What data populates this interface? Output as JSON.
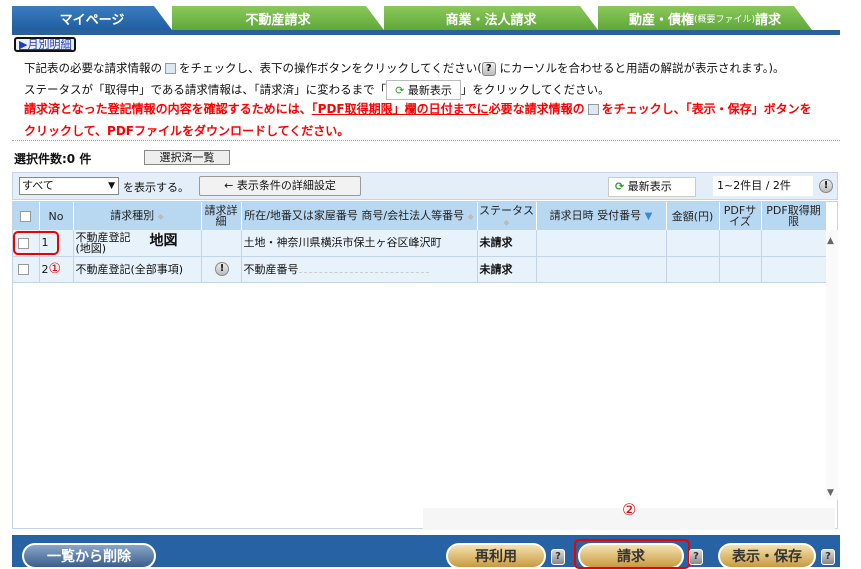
{
  "tabs": [
    "マイページ",
    "不動産請求",
    "商業・法人請求",
    "動産・債権",
    "(概要ファイル)",
    "請求"
  ],
  "monthly_link": "月別明細",
  "instructions": {
    "l1a": "下記表の必要な請求情報の",
    "l1b": "をチェックし、表下の操作ボタンをクリックしてください(",
    "l1c": "にカーソルを合わせると用語の解説が表示されます。)。",
    "l2a": "ステータスが「取得中」である請求情報は、「請求済」に変わるまで「",
    "l2btn": "最新表示",
    "l2b": "」をクリックしてください。",
    "r1a": "請求済となった登記情報の内容を確認するためには、",
    "r1link": "「PDF取得期限」欄の日付までに",
    "r1b": "必要な請求情報の",
    "r1c": "をチェックし、「表示・保存」ボタンを",
    "r2": "クリックして、PDFファイルをダウンロードしてください。"
  },
  "selection": {
    "count_label": "選択件数:0 件",
    "list_button": "選択済一覧"
  },
  "toolbar": {
    "filter_value": "すべて",
    "filter_suffix": "を表示する。",
    "detail_button": "← 表示条件の詳細設定",
    "refresh_button": "最新表示",
    "range": "1~2件目 / 2件"
  },
  "columns": [
    "No",
    "請求種別",
    "請求詳細",
    "所在/地番又は家屋番号 商号/会社法人等番号",
    "ステータス",
    "請求日時 受付番号",
    "金額(円)",
    "PDFサイズ",
    "PDF取得期限"
  ],
  "rows": [
    {
      "no": "1",
      "type": "不動産登記(地図)",
      "annotation": "地図",
      "location": "土地・神奈川県横浜市保土ヶ谷区峰沢町",
      "status": "未請求"
    },
    {
      "no": "2",
      "type": "不動産登記(全部事項)",
      "annotation": "①",
      "location": "不動産番号",
      "status": "未請求"
    }
  ],
  "annotation2": "②",
  "buttons": {
    "delete": "一覧から削除",
    "reuse": "再利用",
    "request": "請求",
    "view_save": "表示・保存",
    "help": "?"
  }
}
